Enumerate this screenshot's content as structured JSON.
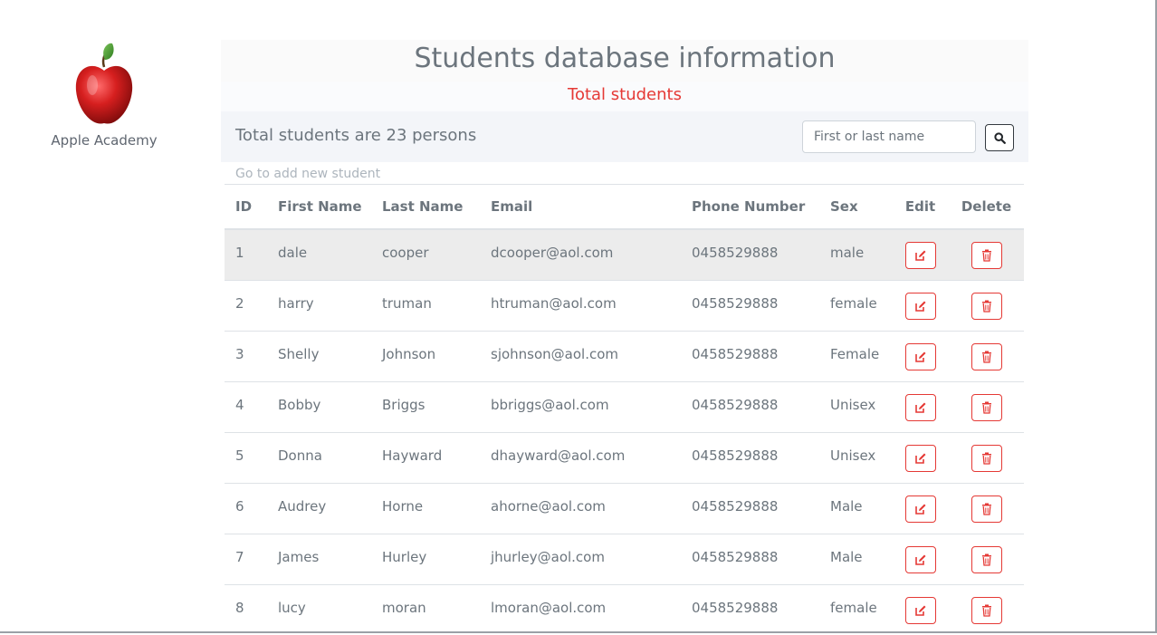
{
  "brand": {
    "name": "Apple Academy"
  },
  "header": {
    "title": "Students database information",
    "subtitle": "Total students"
  },
  "toolbar": {
    "total_text": "Total students are 23 persons",
    "search_placeholder": "First or last name",
    "search_icon": "search-icon",
    "add_link": "Go to add new student"
  },
  "table": {
    "columns": [
      "ID",
      "First Name",
      "Last Name",
      "Email",
      "Phone Number",
      "Sex",
      "Edit",
      "Delete"
    ],
    "rows": [
      {
        "id": "1",
        "first": "dale",
        "last": "cooper",
        "email": "dcooper@aol.com",
        "phone": "0458529888",
        "sex": "male"
      },
      {
        "id": "2",
        "first": "harry",
        "last": "truman",
        "email": "htruman@aol.com",
        "phone": "0458529888",
        "sex": "female"
      },
      {
        "id": "3",
        "first": "Shelly",
        "last": "Johnson",
        "email": "sjohnson@aol.com",
        "phone": "0458529888",
        "sex": "Female"
      },
      {
        "id": "4",
        "first": "Bobby",
        "last": "Briggs",
        "email": "bbriggs@aol.com",
        "phone": "0458529888",
        "sex": "Unisex"
      },
      {
        "id": "5",
        "first": "Donna",
        "last": "Hayward",
        "email": "dhayward@aol.com",
        "phone": "0458529888",
        "sex": "Unisex"
      },
      {
        "id": "6",
        "first": "Audrey",
        "last": "Horne",
        "email": "ahorne@aol.com",
        "phone": "0458529888",
        "sex": "Male"
      },
      {
        "id": "7",
        "first": "James",
        "last": "Hurley",
        "email": "jhurley@aol.com",
        "phone": "0458529888",
        "sex": "Male"
      },
      {
        "id": "8",
        "first": "lucy",
        "last": "moran",
        "email": "lmoran@aol.com",
        "phone": "0458529888",
        "sex": "female"
      }
    ],
    "edit_icon": "edit-icon",
    "delete_icon": "trash-icon"
  },
  "colors": {
    "accent_red": "#e53935",
    "text_gray": "#6c757d",
    "toolbar_bg": "#f3f5f9",
    "highlight_row": "#ececec"
  }
}
